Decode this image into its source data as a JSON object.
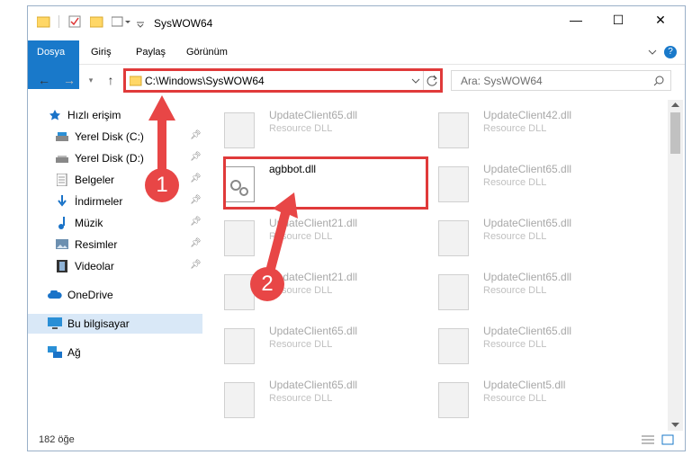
{
  "window": {
    "title": "SysWOW64",
    "minimize_glyph": "—",
    "maximize_glyph": "☐",
    "close_glyph": "✕"
  },
  "ribbon": {
    "tabs": [
      "Dosya",
      "Giriş",
      "Paylaş",
      "Görünüm"
    ],
    "help_glyph": "?"
  },
  "address": {
    "path": "C:\\Windows\\SysWOW64"
  },
  "search": {
    "placeholder": "Ara: SysWOW64"
  },
  "sidebar": {
    "items": [
      {
        "label": "Hızlı erişim",
        "icon": "star-icon"
      },
      {
        "label": "Yerel Disk (C:)",
        "icon": "drive-icon"
      },
      {
        "label": "Yerel Disk (D:)",
        "icon": "drive-icon"
      },
      {
        "label": "Belgeler",
        "icon": "documents-icon"
      },
      {
        "label": "İndirmeler",
        "icon": "download-icon"
      },
      {
        "label": "Müzik",
        "icon": "music-icon"
      },
      {
        "label": "Resimler",
        "icon": "pictures-icon"
      },
      {
        "label": "Videolar",
        "icon": "video-icon"
      },
      {
        "label": "OneDrive",
        "icon": "cloud-icon"
      },
      {
        "label": "Bu bilgisayar",
        "icon": "computer-icon"
      },
      {
        "label": "Ağ",
        "icon": "network-icon"
      }
    ]
  },
  "files": {
    "col1": [
      {
        "name": "UpdateClient65.dll",
        "type": "Resource DLL"
      },
      {
        "name": "agbbot.dll",
        "type": ""
      },
      {
        "name": "UpdateClient21.dll",
        "type": "Resource DLL"
      },
      {
        "name": "UpdateClient21.dll",
        "type": "Resource DLL"
      },
      {
        "name": "UpdateClient65.dll",
        "type": "Resource DLL"
      },
      {
        "name": "UpdateClient65.dll",
        "type": "Resource DLL"
      }
    ],
    "col2": [
      {
        "name": "UpdateClient42.dll",
        "type": "Resource DLL"
      },
      {
        "name": "UpdateClient65.dll",
        "type": "Resource DLL"
      },
      {
        "name": "UpdateClient65.dll",
        "type": "Resource DLL"
      },
      {
        "name": "UpdateClient65.dll",
        "type": "Resource DLL"
      },
      {
        "name": "UpdateClient65.dll",
        "type": "Resource DLL"
      },
      {
        "name": "UpdateClient5.dll",
        "type": "Resource DLL"
      }
    ]
  },
  "status": {
    "count": "182 öğe"
  },
  "annotations": {
    "step1": "1",
    "step2": "2",
    "color": "#e03a3a"
  }
}
